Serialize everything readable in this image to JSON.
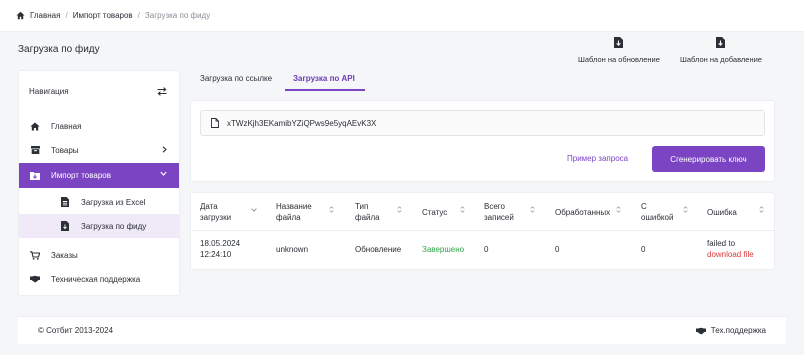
{
  "breadcrumb": {
    "home": "Главная",
    "import": "Импорт товаров",
    "current": "Загрузка по фиду"
  },
  "page": {
    "title": "Загрузка по фиду"
  },
  "templates": {
    "update": "Шаблон на обновление",
    "add": "Шаблон на добавление"
  },
  "sidebar": {
    "header": "Навигация",
    "items": [
      {
        "label": "Главная",
        "icon": "home-icon"
      },
      {
        "label": "Товары",
        "icon": "box-icon"
      },
      {
        "label": "Импорт товаров",
        "icon": "import-icon"
      },
      {
        "label": "Загрузка из Excel",
        "icon": "file-excel-icon"
      },
      {
        "label": "Загрузка по фиду",
        "icon": "file-feed-icon"
      },
      {
        "label": "Заказы",
        "icon": "cart-icon"
      },
      {
        "label": "Техническая поддержка",
        "icon": "handshake-icon"
      }
    ]
  },
  "tabs": [
    {
      "label": "Загрузка по ссылке"
    },
    {
      "label": "Загрузка по API"
    }
  ],
  "api": {
    "key": "xTWzKjh3EKamibYZiQPws9e5yqAEvK3X",
    "example_link": "Пример запроса",
    "generate_button": "Сгенерировать ключ"
  },
  "table": {
    "headers": [
      {
        "l1": "Дата",
        "l2": "загрузки"
      },
      {
        "l1": "Название",
        "l2": "файла"
      },
      {
        "l1": "Тип",
        "l2": "файла"
      },
      {
        "l1": "Статус",
        "l2": ""
      },
      {
        "l1": "Всего",
        "l2": "записей"
      },
      {
        "l1": "Обработанных",
        "l2": ""
      },
      {
        "l1": "С",
        "l2": "ошибкой"
      },
      {
        "l1": "Ошибка",
        "l2": ""
      }
    ],
    "rows": [
      {
        "date": "18.05.2024",
        "time": "12:24:10",
        "file": "unknown",
        "type": "Обновление",
        "status": "Завершено",
        "total": "0",
        "processed": "0",
        "errors": "0",
        "error_text": "failed to",
        "error_link": "download file"
      }
    ]
  },
  "footer": {
    "copyright": "© Сотбит 2013-2024",
    "support": "Тех.поддержка"
  },
  "colors": {
    "accent": "#7b44c2",
    "success": "#2fa54b",
    "error": "#d93a3a"
  }
}
